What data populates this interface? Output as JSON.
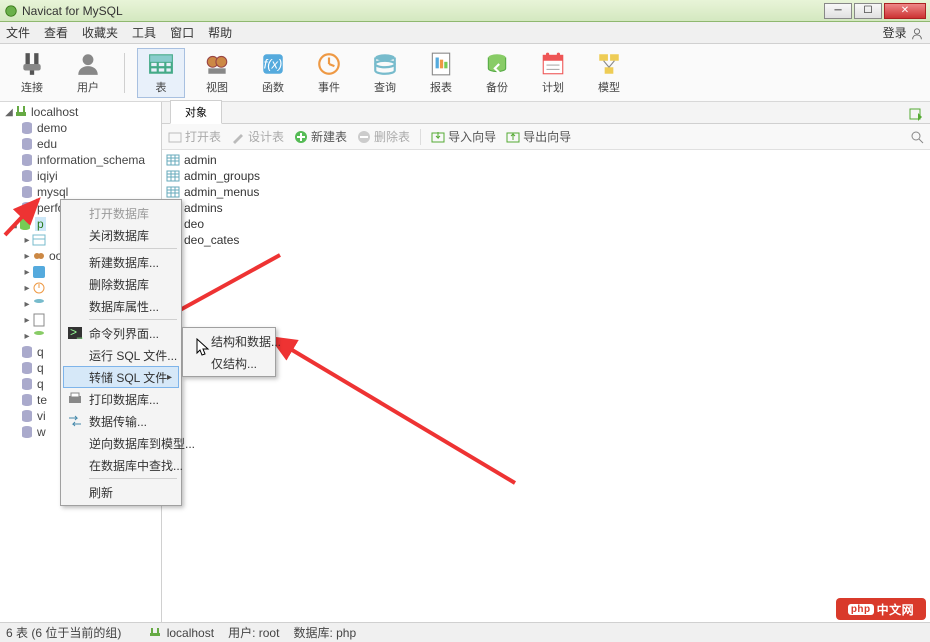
{
  "app": {
    "title": "Navicat for MySQL"
  },
  "menus": [
    "文件",
    "查看",
    "收藏夹",
    "工具",
    "窗口",
    "帮助"
  ],
  "login_label": "登录",
  "toolbar": [
    {
      "label": "连接",
      "icon": "plug"
    },
    {
      "label": "用户",
      "icon": "user"
    },
    {
      "sep": true
    },
    {
      "label": "表",
      "icon": "table",
      "selected": true
    },
    {
      "label": "视图",
      "icon": "view"
    },
    {
      "label": "函数",
      "icon": "fx"
    },
    {
      "label": "事件",
      "icon": "event"
    },
    {
      "label": "查询",
      "icon": "query"
    },
    {
      "label": "报表",
      "icon": "report"
    },
    {
      "label": "备份",
      "icon": "backup"
    },
    {
      "label": "计划",
      "icon": "schedule"
    },
    {
      "label": "模型",
      "icon": "model"
    }
  ],
  "connection": {
    "name": "localhost"
  },
  "databases": [
    "demo",
    "edu",
    "information_schema",
    "iqiyi",
    "mysql",
    "performance_schema"
  ],
  "active_db_prefix": "p",
  "db_children": [
    {
      "label": "",
      "icon": "tables"
    },
    {
      "label": "oo",
      "icon": "views"
    },
    {
      "label": "",
      "icon": "fx"
    },
    {
      "label": "",
      "icon": "events"
    },
    {
      "label": "",
      "icon": "queries"
    },
    {
      "label": "",
      "icon": "reports"
    },
    {
      "label": "",
      "icon": "backups"
    }
  ],
  "other_dbs": [
    "q",
    "q",
    "q",
    "te",
    "vi",
    "w"
  ],
  "main_tab": "对象",
  "subtoolbar": {
    "open": "打开表",
    "design": "设计表",
    "new": "新建表",
    "delete": "删除表",
    "import": "导入向导",
    "export": "导出向导"
  },
  "tables": [
    "admin",
    "admin_groups",
    "admin_menus",
    "admins",
    "deo",
    "deo_cates"
  ],
  "context_menu": {
    "items": [
      {
        "label": "打开数据库",
        "disabled": true
      },
      {
        "label": "关闭数据库"
      },
      {
        "sep": true
      },
      {
        "label": "新建数据库..."
      },
      {
        "label": "删除数据库"
      },
      {
        "label": "数据库属性..."
      },
      {
        "sep": true
      },
      {
        "label": "命令列界面...",
        "icon": "console"
      },
      {
        "label": "运行 SQL 文件..."
      },
      {
        "label": "转储 SQL 文件",
        "submenu": true,
        "hover": true
      },
      {
        "label": "打印数据库...",
        "icon": "print"
      },
      {
        "label": "数据传输...",
        "icon": "transfer"
      },
      {
        "label": "逆向数据库到模型..."
      },
      {
        "label": "在数据库中查找..."
      },
      {
        "sep": true
      },
      {
        "label": "刷新"
      }
    ],
    "submenu": [
      {
        "label": "结构和数据..."
      },
      {
        "label": "仅结构..."
      }
    ]
  },
  "status": {
    "count": "6 表 (6 位于当前的组)",
    "server": "localhost",
    "user_label": "用户:",
    "user": "root",
    "db_label": "数据库:",
    "db": "php"
  },
  "watermark": "中文网",
  "watermark_prefix": "php"
}
